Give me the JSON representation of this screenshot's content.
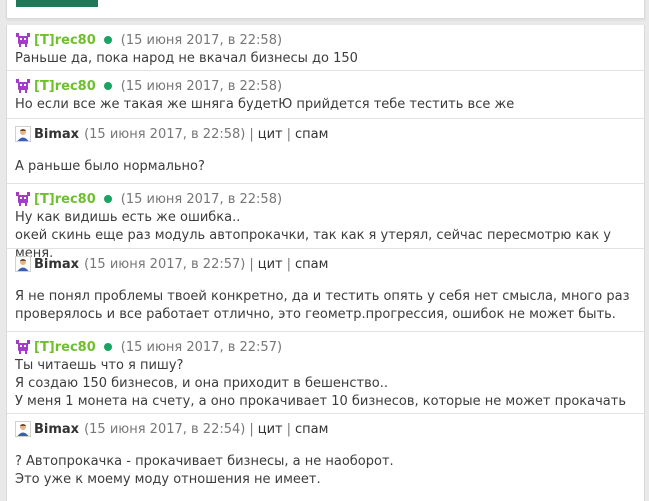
{
  "top_panel": {
    "button_color": "#1f7a58"
  },
  "colors": {
    "nick_tester": "#6fbf2f",
    "online_dot": "#19a463"
  },
  "messages": [
    {
      "nick": "[T]rec80",
      "time": "(15 июня 2017, в 22:58)",
      "lines": [
        "Раньше да, пока народ не вкачал бизнесы до 150"
      ]
    },
    {
      "nick": "[T]rec80",
      "time": "(15 июня 2017, в 22:58)",
      "lines": [
        "Но если все же такая же шняга будетЮ прийдется тебе тестить все же"
      ]
    },
    {
      "nick": "Bimax",
      "time": "(15 июня 2017, в 22:58)",
      "quote": "цит",
      "spam": "спам",
      "lines": [
        "А раньше было нормально?"
      ]
    },
    {
      "nick": "[T]rec80",
      "time": "(15 июня 2017, в 22:58)",
      "lines": [
        "Ну как видишь есть же ошибка..",
        "окей скинь еще раз модуль автопрокачки, так как я утерял, сейчас пересмотрю как у меня."
      ]
    },
    {
      "nick": "Bimax",
      "time": "(15 июня 2017, в 22:57)",
      "quote": "цит",
      "spam": "спам",
      "lines": [
        "Я не понял проблемы твоей конкретно, да и тестить опять у себя нет смысла, много раз",
        "проверялось и все работает отлично, это геометр.прогрессия, ошибок не может быть."
      ]
    },
    {
      "nick": "[T]rec80",
      "time": "(15 июня 2017, в 22:57)",
      "lines": [
        "Ты читаешь что я пишу?",
        "Я создаю 150 бизнесов, и она приходит в бешенство..",
        "У меня 1 монета на счету, а оно прокачивает 10 бизнесов, которые не может прокачать"
      ]
    },
    {
      "nick": "Bimax",
      "time": "(15 июня 2017, в 22:54)",
      "quote": "цит",
      "spam": "спам",
      "lines": [
        "? Автопрокачка - прокачивает бизнесы, а не наоборот.",
        "Это уже к моему моду отношения не имеет."
      ]
    }
  ]
}
